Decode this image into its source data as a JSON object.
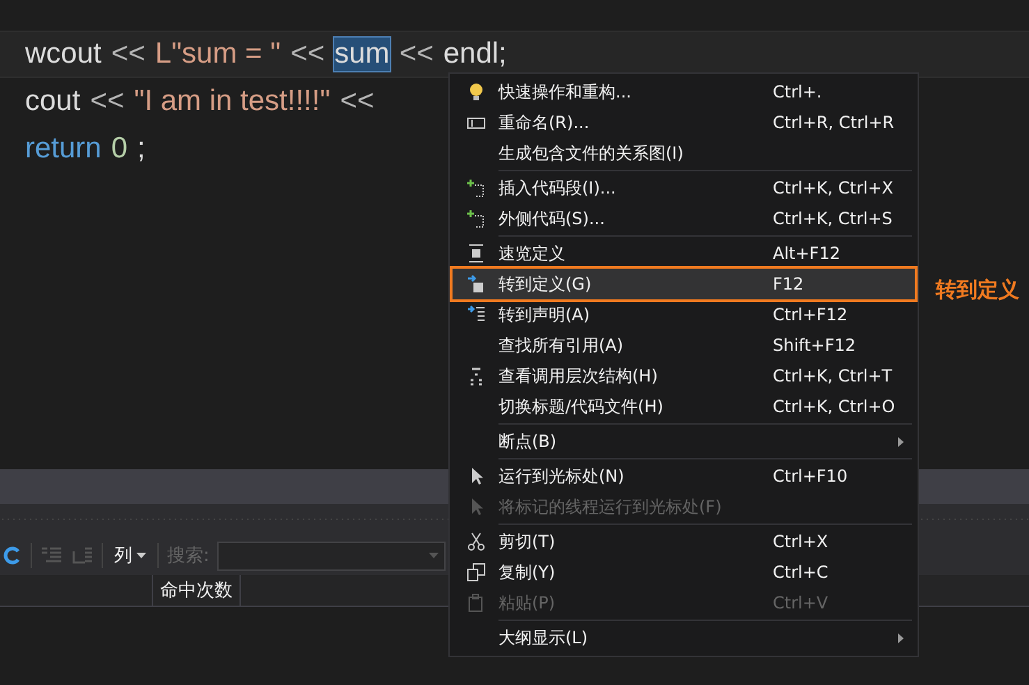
{
  "code_lines": [
    {
      "highlighted": true,
      "tokens": [
        {
          "kind": "ident",
          "text": "wcout"
        },
        {
          "kind": "op",
          "text": "<<"
        },
        {
          "kind": "string",
          "text": "L\"sum = \""
        },
        {
          "kind": "op",
          "text": "<<"
        },
        {
          "kind": "ident",
          "text": "sum",
          "selected": true
        },
        {
          "kind": "op",
          "text": "<<"
        },
        {
          "kind": "ident",
          "text": "endl;"
        }
      ]
    },
    {
      "highlighted": false,
      "tokens": [
        {
          "kind": "ident",
          "text": "cout"
        },
        {
          "kind": "op",
          "text": "<<"
        },
        {
          "kind": "string",
          "text": "\"I am in test!!!!\""
        },
        {
          "kind": "op",
          "text": "<<"
        }
      ]
    },
    {
      "highlighted": false,
      "tokens": [
        {
          "kind": "keyword",
          "text": "return"
        },
        {
          "kind": "number",
          "text": "0"
        },
        {
          "kind": "ident",
          "text": ";"
        }
      ]
    }
  ],
  "toolbar": {
    "columns_button": "列",
    "search_label": "搜索:"
  },
  "table": {
    "columns": [
      "命中次数"
    ]
  },
  "context_menu": {
    "items": [
      {
        "kind": "item",
        "label": "快速操作和重构...",
        "shortcut": "Ctrl+.",
        "disabled": false,
        "selected": false,
        "submenu": false
      },
      {
        "kind": "item",
        "label": "重命名(R)...",
        "shortcut": "Ctrl+R, Ctrl+R",
        "disabled": false,
        "selected": false,
        "submenu": false
      },
      {
        "kind": "item",
        "label": "生成包含文件的关系图(I)",
        "disabled": false,
        "selected": false,
        "submenu": false
      },
      {
        "kind": "separator"
      },
      {
        "kind": "item",
        "label": "插入代码段(I)...",
        "shortcut": "Ctrl+K, Ctrl+X",
        "disabled": false,
        "selected": false,
        "submenu": false
      },
      {
        "kind": "item",
        "label": "外侧代码(S)...",
        "shortcut": "Ctrl+K, Ctrl+S",
        "disabled": false,
        "selected": false,
        "submenu": false
      },
      {
        "kind": "separator"
      },
      {
        "kind": "item",
        "label": "速览定义",
        "shortcut": "Alt+F12",
        "disabled": false,
        "selected": false,
        "submenu": false
      },
      {
        "kind": "item",
        "label": "转到定义(G)",
        "shortcut": "F12",
        "disabled": false,
        "selected": true,
        "submenu": false
      },
      {
        "kind": "item",
        "label": "转到声明(A)",
        "shortcut": "Ctrl+F12",
        "disabled": false,
        "selected": false,
        "submenu": false
      },
      {
        "kind": "item",
        "label": "查找所有引用(A)",
        "shortcut": "Shift+F12",
        "disabled": false,
        "selected": false,
        "submenu": false
      },
      {
        "kind": "item",
        "label": "查看调用层次结构(H)",
        "shortcut": "Ctrl+K, Ctrl+T",
        "disabled": false,
        "selected": false,
        "submenu": false
      },
      {
        "kind": "item",
        "label": "切换标题/代码文件(H)",
        "shortcut": "Ctrl+K, Ctrl+O",
        "disabled": false,
        "selected": false,
        "submenu": false
      },
      {
        "kind": "separator"
      },
      {
        "kind": "item",
        "label": "断点(B)",
        "disabled": false,
        "selected": false,
        "submenu": true
      },
      {
        "kind": "separator"
      },
      {
        "kind": "item",
        "label": "运行到光标处(N)",
        "shortcut": "Ctrl+F10",
        "disabled": false,
        "selected": false,
        "submenu": false
      },
      {
        "kind": "item",
        "label": "将标记的线程运行到光标处(F)",
        "disabled": true,
        "selected": false,
        "submenu": false
      },
      {
        "kind": "separator"
      },
      {
        "kind": "item",
        "label": "剪切(T)",
        "shortcut": "Ctrl+X",
        "disabled": false,
        "selected": false,
        "submenu": false
      },
      {
        "kind": "item",
        "label": "复制(Y)",
        "shortcut": "Ctrl+C",
        "disabled": false,
        "selected": false,
        "submenu": false
      },
      {
        "kind": "item",
        "label": "粘贴(P)",
        "shortcut": "Ctrl+V",
        "disabled": true,
        "selected": false,
        "submenu": false
      },
      {
        "kind": "separator"
      },
      {
        "kind": "item",
        "label": "大纲显示(L)",
        "disabled": false,
        "selected": false,
        "submenu": true
      }
    ]
  },
  "callout": {
    "label": "转到定义"
  }
}
